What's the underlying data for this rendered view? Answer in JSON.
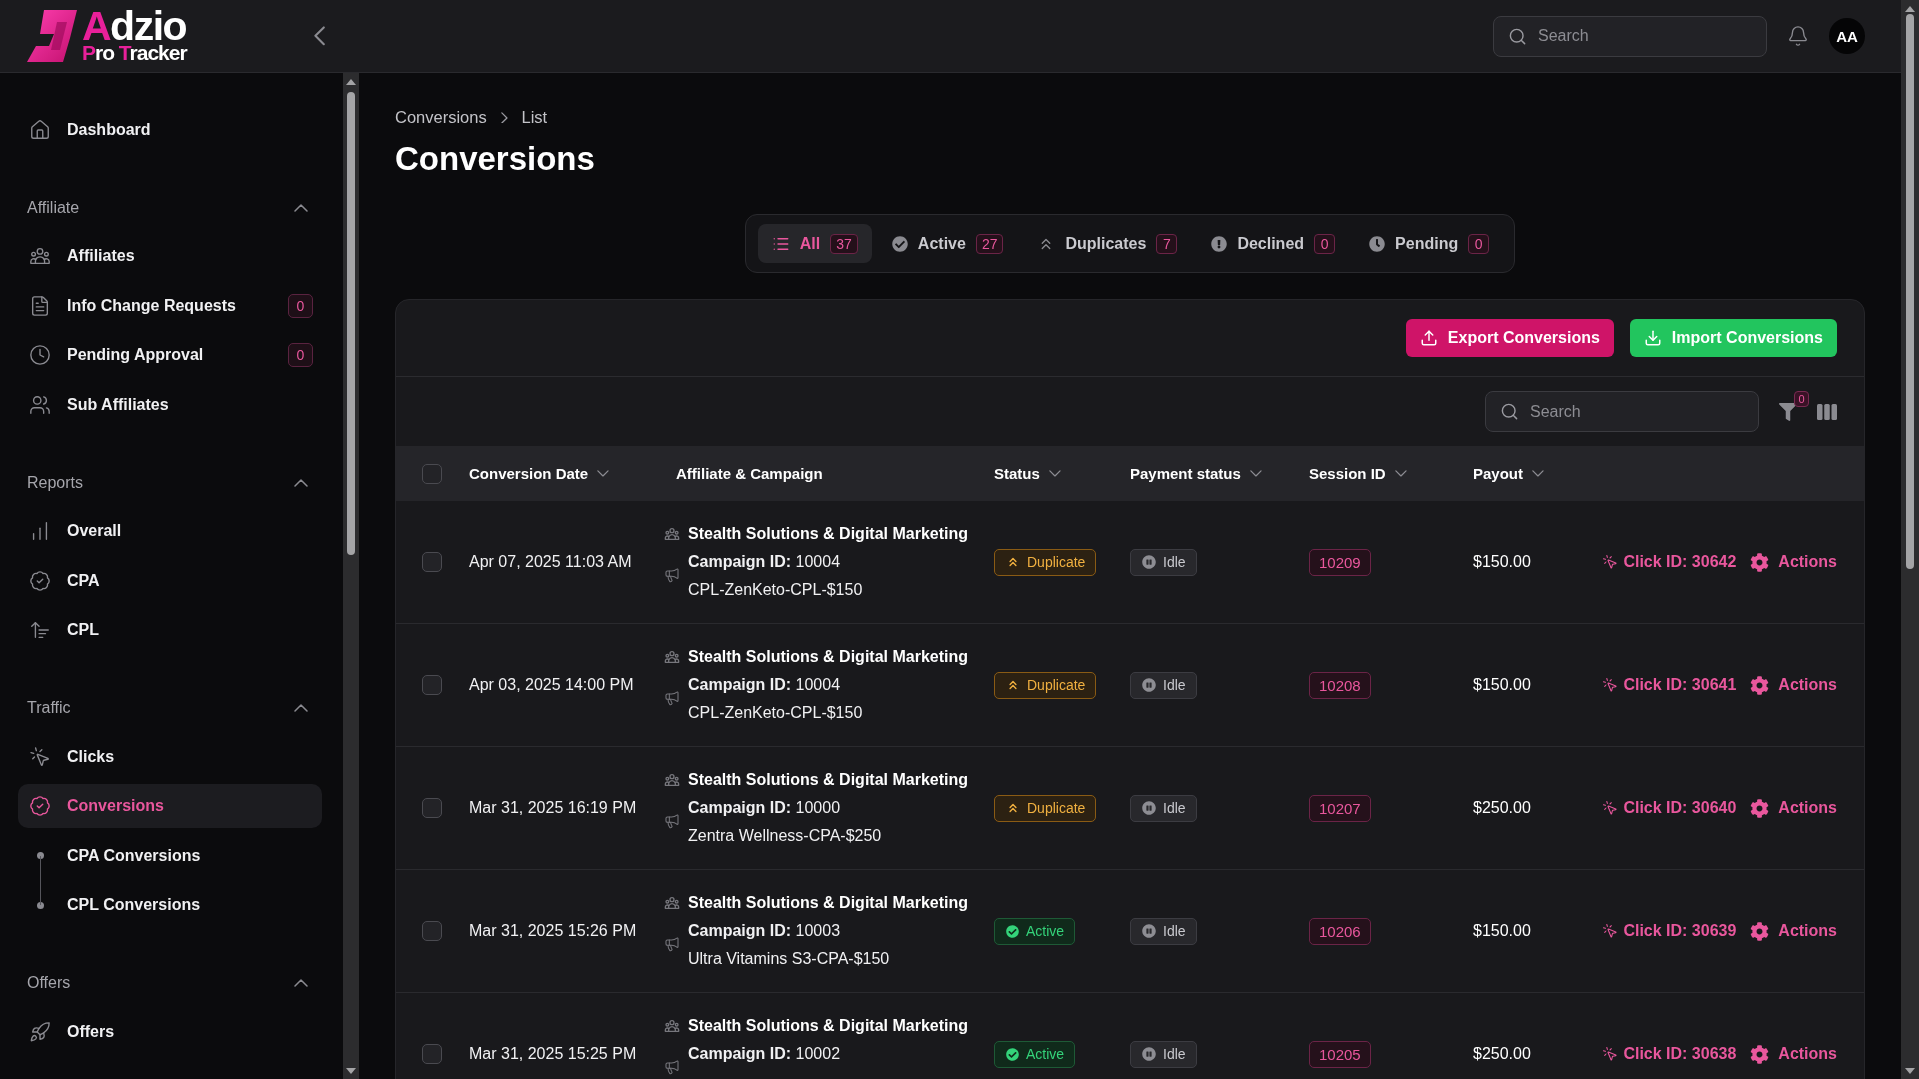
{
  "brand": {
    "name": "Adzio",
    "tagline": "Pro Tracker"
  },
  "header": {
    "search": {
      "placeholder": "Search"
    },
    "avatar": "AA"
  },
  "sidebar": {
    "top": [
      {
        "label": "Dashboard",
        "selected": false
      }
    ],
    "sections": [
      {
        "title": "Affiliate",
        "expanded": true,
        "items": [
          {
            "label": "Affiliates",
            "selected": false
          },
          {
            "label": "Info Change Requests",
            "badge": "0",
            "selected": false
          },
          {
            "label": "Pending Approval",
            "badge": "0",
            "selected": false
          },
          {
            "label": "Sub Affiliates",
            "selected": false
          }
        ]
      },
      {
        "title": "Reports",
        "expanded": true,
        "items": [
          {
            "label": "Overall",
            "selected": false
          },
          {
            "label": "CPA",
            "selected": false
          },
          {
            "label": "CPL",
            "selected": false
          }
        ]
      },
      {
        "title": "Traffic",
        "expanded": true,
        "items": [
          {
            "label": "Clicks",
            "selected": false
          },
          {
            "label": "Conversions",
            "selected": true,
            "children": [
              {
                "label": "CPA Conversions",
                "selected": false
              },
              {
                "label": "CPL Conversions",
                "selected": false
              }
            ]
          }
        ]
      },
      {
        "title": "Offers",
        "expanded": true,
        "items": [
          {
            "label": "Offers",
            "selected": false
          }
        ]
      }
    ]
  },
  "breadcrumb": [
    "Conversions",
    "List"
  ],
  "title": "Conversions",
  "tabs": [
    {
      "label": "All",
      "count": "37",
      "selected": true
    },
    {
      "label": "Active",
      "count": "27",
      "selected": false
    },
    {
      "label": "Duplicates",
      "count": "7",
      "selected": false
    },
    {
      "label": "Declined",
      "count": "0",
      "selected": false
    },
    {
      "label": "Pending",
      "count": "0",
      "selected": false
    }
  ],
  "actions": [
    {
      "label": "Export Conversions",
      "kind": "export"
    },
    {
      "label": "Import Conversions",
      "kind": "import"
    }
  ],
  "table": {
    "search": {
      "placeholder": "Search"
    },
    "filter_count": "0",
    "select_all": {
      "checked": false
    },
    "columns": [
      {
        "label": "Conversion Date",
        "sortable": true
      },
      {
        "label": "Affiliate & Campaign",
        "sortable": false
      },
      {
        "label": "Status",
        "sortable": true
      },
      {
        "label": "Payment status",
        "sortable": true
      },
      {
        "label": "Session ID",
        "sortable": true
      },
      {
        "label": "Payout",
        "sortable": true
      }
    ],
    "rows": [
      {
        "checked": false,
        "date": "Apr 07, 2025 11:03 AM",
        "affiliate": "Stealth Solutions & Digital Marketing",
        "campaign_id": "**Campaign ID:** 10004",
        "campaign": "CPL-ZenKeto-CPL-$150",
        "status": {
          "label": "Duplicate",
          "kind": "duplicate"
        },
        "payment_status": {
          "label": "Idle",
          "kind": "idle"
        },
        "session_id": "10209",
        "payout": "$150.00",
        "click_id": "Click ID: 30642",
        "action": "Actions"
      },
      {
        "checked": false,
        "date": "Apr 03, 2025 14:00 PM",
        "affiliate": "Stealth Solutions & Digital Marketing",
        "campaign_id": "**Campaign ID:** 10004",
        "campaign": "CPL-ZenKeto-CPL-$150",
        "status": {
          "label": "Duplicate",
          "kind": "duplicate"
        },
        "payment_status": {
          "label": "Idle",
          "kind": "idle"
        },
        "session_id": "10208",
        "payout": "$150.00",
        "click_id": "Click ID: 30641",
        "action": "Actions"
      },
      {
        "checked": false,
        "date": "Mar 31, 2025 16:19 PM",
        "affiliate": "Stealth Solutions & Digital Marketing",
        "campaign_id": "**Campaign ID:** 10000",
        "campaign": "Zentra Wellness-CPA-$250",
        "status": {
          "label": "Duplicate",
          "kind": "duplicate"
        },
        "payment_status": {
          "label": "Idle",
          "kind": "idle"
        },
        "session_id": "10207",
        "payout": "$250.00",
        "click_id": "Click ID: 30640",
        "action": "Actions"
      },
      {
        "checked": false,
        "date": "Mar 31, 2025 15:26 PM",
        "affiliate": "Stealth Solutions & Digital Marketing",
        "campaign_id": "**Campaign ID:** 10003",
        "campaign": "Ultra Vitamins S3-CPA-$150",
        "status": {
          "label": "Active",
          "kind": "active"
        },
        "payment_status": {
          "label": "Idle",
          "kind": "idle"
        },
        "session_id": "10206",
        "payout": "$150.00",
        "click_id": "Click ID: 30639",
        "action": "Actions"
      },
      {
        "checked": false,
        "date": "Mar 31, 2025 15:25 PM",
        "affiliate": "Stealth Solutions & Digital Marketing",
        "campaign_id": "**Campaign ID:** 10002",
        "status": {
          "label": "Active",
          "kind": "active"
        },
        "payment_status": {
          "label": "Idle",
          "kind": "idle"
        },
        "session_id": "10205",
        "payout": "$250.00",
        "click_id": "Click ID: 30638",
        "action": "Actions"
      }
    ]
  }
}
